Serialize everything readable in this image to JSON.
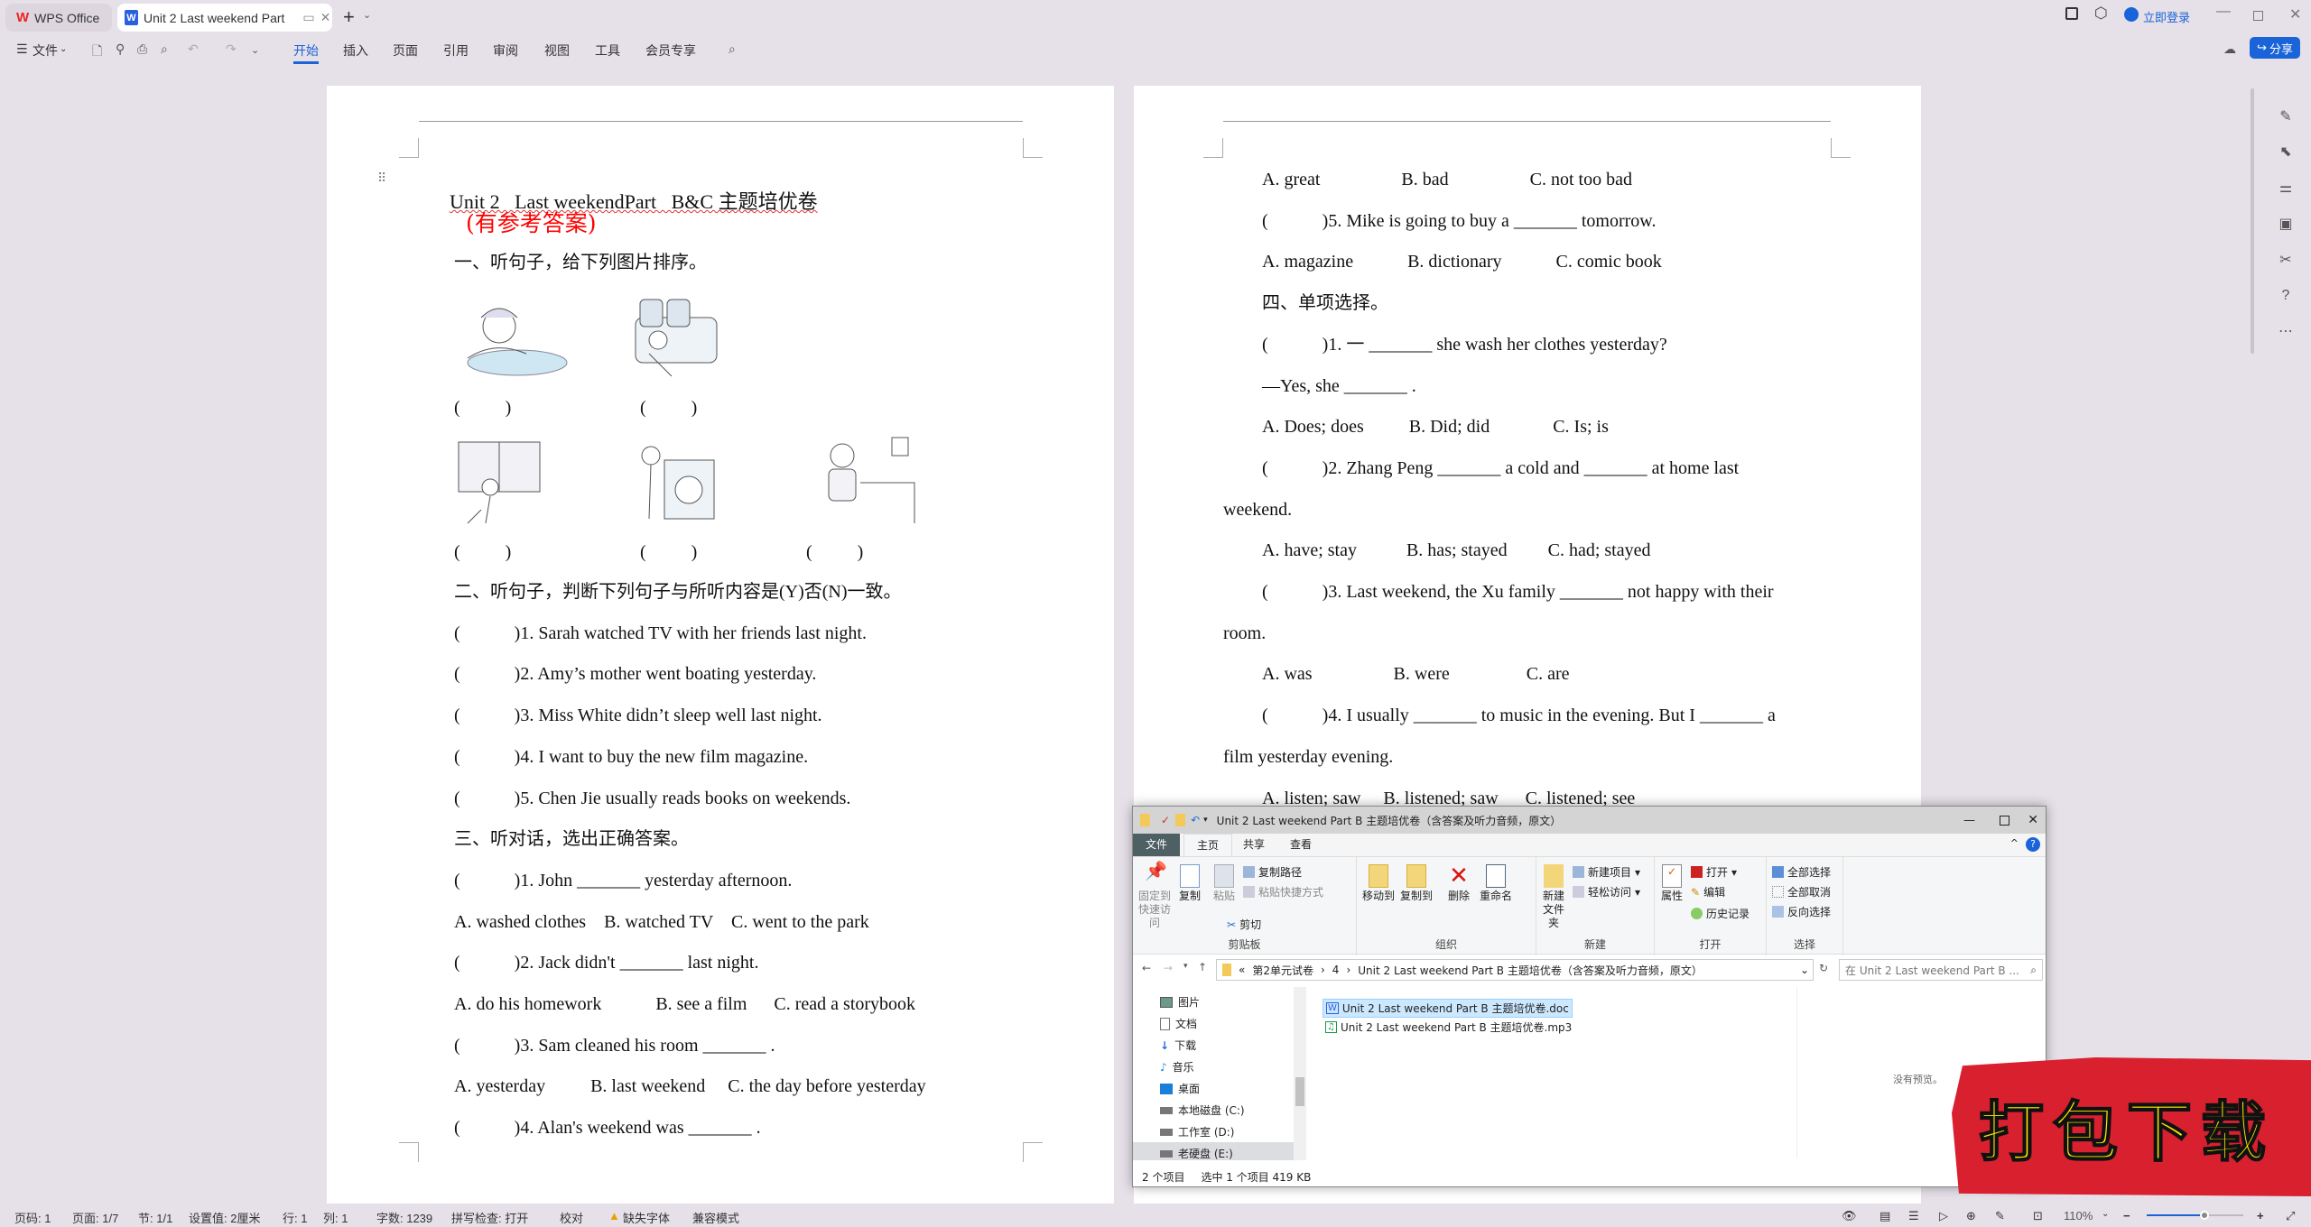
{
  "app": {
    "home_tab": "WPS Office",
    "doc_tab": "Unit 2   Last weekend Part",
    "login": "立即登录",
    "share": "分享",
    "accent": "#1a63d8"
  },
  "toolbar": {
    "file_menu": "文件",
    "tabs": [
      "开始",
      "插入",
      "页面",
      "引用",
      "审阅",
      "视图",
      "工具",
      "会员专享"
    ],
    "active_tab": "开始"
  },
  "doc": {
    "title": "Unit 2   Last weekendPart   B&C 主题培优卷",
    "answer_tag": "(有参考答案)",
    "answer_tag_color": "#ff0000",
    "section1": "一、听句子，给下列图片排序。",
    "picture_parens": [
      "(          )",
      "(          )",
      "(          )",
      "(          )",
      "(          )"
    ],
    "left_lines": [
      "二、听句子，判断下列句子与所听内容是(Y)否(N)一致。",
      "(            )1. Sarah watched TV with her friends last night.",
      "(            )2. Amy’s mother went boating yesterday.",
      "(            )3. Miss White didn’t sleep well last night.",
      "(            )4. I want to buy the new film magazine.",
      "(            )5. Chen Jie usually reads books on weekends.",
      "三、听对话，选出正确答案。",
      "(            )1. John _______ yesterday afternoon.",
      "A. washed clothes    B. watched TV    C. went to the park",
      "(            )2. Jack didn't _______ last night.",
      "A. do his homework            B. see a film      C. read a storybook",
      "(            )3. Sam cleaned his room _______ .",
      "A. yesterday          B. last weekend     C. the day before yesterday",
      "(            )4. Alan's weekend was _______ ."
    ],
    "right_lines": [
      "A. great                  B. bad                  C. not too bad",
      "(            )5. Mike is going to buy a _______ tomorrow.",
      "A. magazine            B. dictionary            C. comic book",
      "四、单项选择。",
      "(            )1. 一 _______ she wash her clothes yesterday?",
      "—Yes, she _______ .",
      "A. Does; does          B. Did; did              C. Is; is",
      "(            )2. Zhang Peng _______ a cold and _______ at home last",
      "weekend.",
      "A. have; stay           B. has; stayed         C. had; stayed",
      "(            )3. Last weekend, the Xu family _______ not happy with their",
      "room.",
      "A. was                  B. were                 C. are",
      "(            )4. I usually _______ to music in the evening. But I _______ a",
      "film yesterday evening.",
      "A. listen; saw     B. listened; saw      C. listened; see"
    ]
  },
  "status": {
    "items": [
      "页码: 1",
      "页面: 1/7",
      "节: 1/1",
      "设置值: 2厘米",
      "行: 1",
      "列: 1",
      "字数: 1239",
      "拼写检查: 打开",
      "校对",
      "缺失字体",
      "兼容模式"
    ],
    "zoom": "110%",
    "zoom_slider_percent": 60
  },
  "explorer": {
    "title": "Unit 2 Last weekend Part  B 主题培优卷（含答案及听力音频，原文）",
    "tabs": [
      "文件",
      "主页",
      "共享",
      "查看"
    ],
    "active_tab": "主页",
    "ribbon": {
      "pin": "固定到快速访问",
      "copy": "复制",
      "paste": "粘贴",
      "copy_path": "复制路径",
      "paste_shortcut": "粘贴快捷方式",
      "cut": "剪切",
      "move_to": "移动到",
      "copy_to": "复制到",
      "delete": "删除",
      "rename": "重命名",
      "new_folder": "新建文件夹",
      "new_item": "新建项目",
      "easy_access": "轻松访问",
      "properties": "属性",
      "open": "打开",
      "edit": "编辑",
      "history": "历史记录",
      "select_all": "全部选择",
      "select_none": "全部取消",
      "invert": "反向选择",
      "groups": [
        "剪贴板",
        "组织",
        "新建",
        "打开",
        "选择"
      ]
    },
    "breadcrumb": [
      "第2单元试卷",
      "4",
      "Unit 2 Last weekend Part  B 主题培优卷（含答案及听力音频，原文）"
    ],
    "search_placeholder": "在 Unit 2 Last weekend Part  B ...",
    "nav": [
      "图片",
      "文档",
      "下载",
      "音乐",
      "桌面",
      "本地磁盘 (C:)",
      "工作室 (D:)",
      "老硬盘 (E:)"
    ],
    "files": [
      "Unit 2   Last weekend Part  B 主题培优卷.doc",
      "Unit 2   Last weekend Part  B 主题培优卷.mp3"
    ],
    "preview": "没有预览。",
    "status_count": "2 个项目",
    "status_selected": "选中 1 个项目  419 KB"
  },
  "watermark": {
    "text": "打包下载",
    "bg": "#d8202f",
    "fg": "#ffee00"
  }
}
